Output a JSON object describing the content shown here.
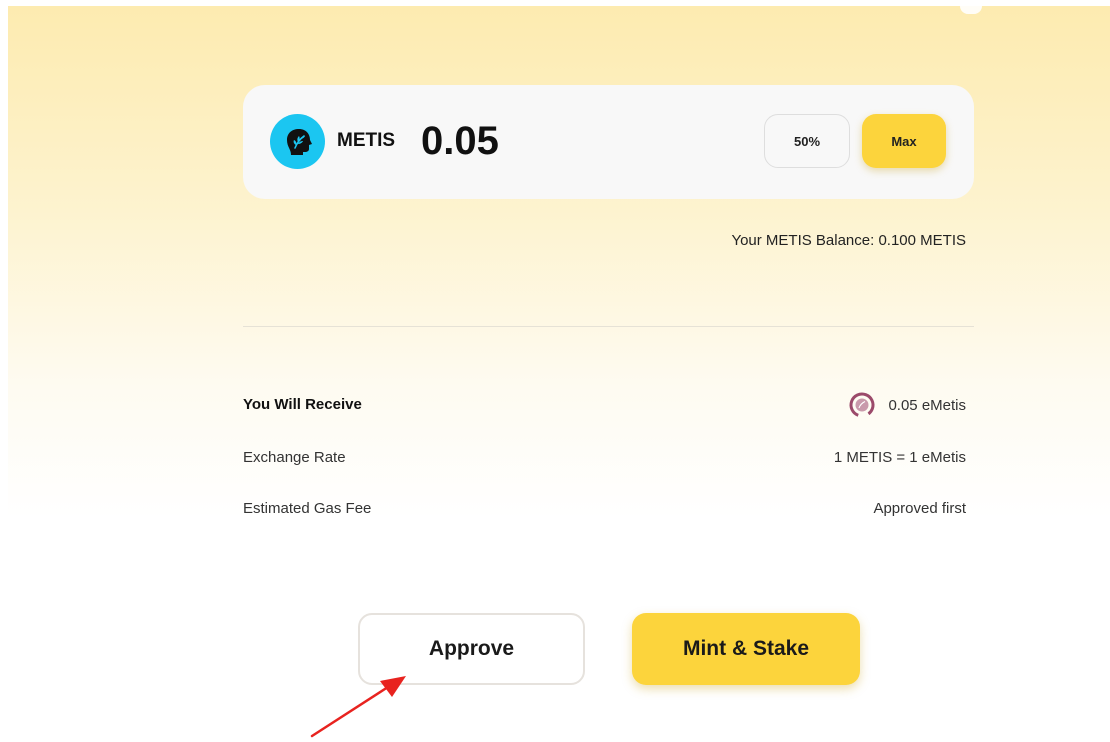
{
  "token": {
    "symbol": "METIS",
    "amount": "0.05",
    "icon": "metis-token-icon",
    "icon_color": "#1bc6f1"
  },
  "quick_buttons": {
    "half_label": "50%",
    "max_label": "Max"
  },
  "balance_text": "Your METIS Balance: 0.100 METIS",
  "details": {
    "receive_label": "You Will Receive",
    "receive_value": "0.05 eMetis",
    "receive_icon": "emetis-token-icon",
    "rate_label": "Exchange Rate",
    "rate_value": "1 METIS = 1 eMetis",
    "gas_label": "Estimated Gas Fee",
    "gas_value": "Approved first"
  },
  "actions": {
    "approve_label": "Approve",
    "mint_label": "Mint & Stake"
  },
  "colors": {
    "accent": "#fcd43c",
    "annotation_arrow": "#e8231f",
    "emetis_icon": "#9b4a6a"
  }
}
